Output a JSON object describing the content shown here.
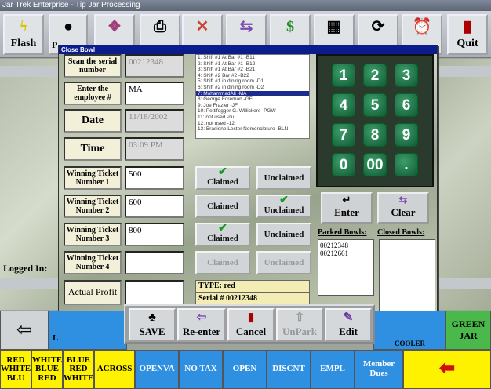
{
  "app_title": "Jar Trek Enterprise - Tip Jar Processing",
  "toolbar": {
    "flash_label": "Flash",
    "quit_label": "Quit",
    "p_partial": "P"
  },
  "side": {
    "logged_in": "Logged In:"
  },
  "dialog": {
    "title": "Close Bowl",
    "serial_label": "Scan the serial number",
    "serial_value": "00212348",
    "employee_label": "Enter the employee #",
    "employee_value": "MA",
    "date_label": "Date",
    "date_value": "11/18/2002",
    "time_label": "Time",
    "time_value": "03:09 PM",
    "winning": [
      {
        "label": "Winning Ticket Number 1",
        "value": "500",
        "claimed": "Claimed",
        "unclaimed": "Unclaimed"
      },
      {
        "label": "Winning Ticket Number 2",
        "value": "600",
        "claimed": "Claimed",
        "unclaimed": "Unclaimed"
      },
      {
        "label": "Winning Ticket Number 3",
        "value": "800",
        "claimed": "Claimed",
        "unclaimed": "Unclaimed"
      },
      {
        "label": "Winning Ticket Number 4",
        "value": "",
        "claimed": "Claimed",
        "unclaimed": "Unclaimed"
      }
    ],
    "profit_label": "Actual Profit",
    "employee_list": [
      "1: Shift #1 At Bar #1         -B11",
      "2: Shift #1 At Bar #1         -B12",
      "3: Shift #1 At Bar #2         -B21",
      "4: Shift #2 Bar #2            -B22",
      "5: Shift #1 in dining room    -D1",
      "6: Shift #2 in dining room    -D2",
      "7: MohammadAli               -MA",
      "8: George Foreman            -GF",
      "9: Joe Frazier                -JF",
      "10: Pettifogger G. Willickers  -PGW",
      "11: not used                 -nu",
      "12: not used                 -12",
      "13: Brasiene Lester Nomenclature -BLN"
    ],
    "type_label": "TYPE:",
    "type_value": "red",
    "serial_hash_label": "Serial #",
    "serial_hash_value": "00212348",
    "keypad": [
      "1",
      "2",
      "3",
      "4",
      "5",
      "6",
      "7",
      "8",
      "9",
      "0",
      "00",
      "."
    ],
    "enter_label": "Enter",
    "clear_label": "Clear",
    "parked_label": "Parked Bowls:",
    "closed_label": "Closed Bowls:",
    "parked_bowls": [
      "00212348",
      "00212661"
    ],
    "actions": {
      "save": "SAVE",
      "reenter": "Re-enter",
      "cancel": "Cancel",
      "unpark": "UnPark",
      "edit": "Edit"
    }
  },
  "bottom": {
    "b1": "RED WHITE BLU",
    "b2": "WHITE BLUE RED",
    "b3": "BLUE RED WHITE",
    "b4": "ACROSS",
    "b5": "OPENVA",
    "b6": "NO TAX",
    "b7": "OPEN",
    "b8": "DISCNT",
    "b9": "EMPL",
    "b10": "Member Dues",
    "green_jar": "GREEN JAR",
    "cooler_partial": "COOLER",
    "l_partial": "L"
  },
  "colors": {
    "title_bar": "#0b1c8c",
    "key_green": "#0f5a34",
    "yellow_btn": "#fff200",
    "blue_btn": "#2f8fe0"
  }
}
